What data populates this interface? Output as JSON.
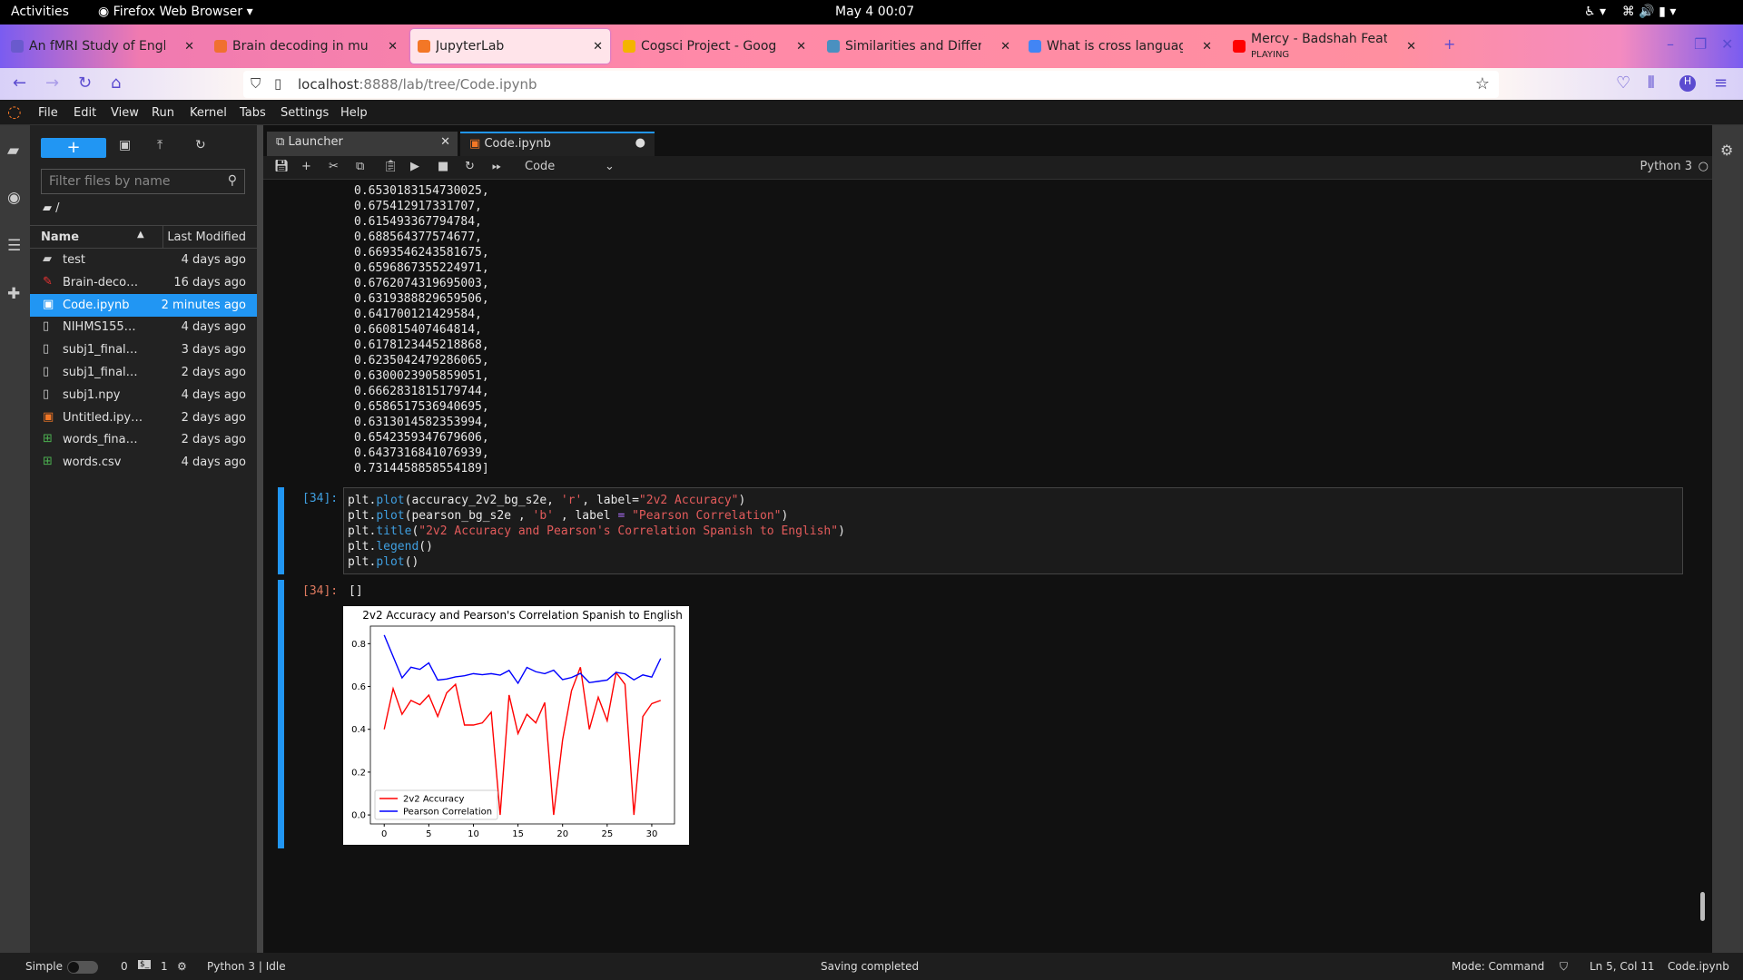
{
  "system": {
    "activities": "Activities",
    "app": "Firefox Web Browser",
    "clock": "May 4  00:07"
  },
  "browser": {
    "tabs": [
      {
        "title": "An fMRI Study of English",
        "color": "#6a5acd"
      },
      {
        "title": "Brain decoding in multipl",
        "color": "#f07030"
      },
      {
        "title": "JupyterLab",
        "color": "#f37726"
      },
      {
        "title": "Cogsci Project - Google Sl",
        "color": "#f4b400"
      },
      {
        "title": "Similarities and Differenc",
        "color": "#4a90c0"
      },
      {
        "title": "What is cross language si",
        "color": "#4285f4"
      },
      {
        "title": "Mercy - Badshah Feat. La",
        "sub": "PLAYING",
        "color": "#ff0000"
      }
    ],
    "url_host": "localhost",
    "url_rest": ":8888/lab/tree/Code.ipynb"
  },
  "menu": [
    "File",
    "Edit",
    "View",
    "Run",
    "Kernel",
    "Tabs",
    "Settings",
    "Help"
  ],
  "filebrowser": {
    "filter_placeholder": "Filter files by name",
    "path": "/",
    "col_name": "Name",
    "col_modified": "Last Modified",
    "files": [
      {
        "name": "test",
        "modified": "4 days ago",
        "type": "folder"
      },
      {
        "name": "Brain-deco…",
        "modified": "16 days ago",
        "type": "pdf"
      },
      {
        "name": "Code.ipynb",
        "modified": "2 minutes ago",
        "type": "notebook",
        "selected": true
      },
      {
        "name": "NIHMS155…",
        "modified": "4 days ago",
        "type": "file"
      },
      {
        "name": "subj1_final…",
        "modified": "3 days ago",
        "type": "file"
      },
      {
        "name": "subj1_final…",
        "modified": "2 days ago",
        "type": "file"
      },
      {
        "name": "subj1.npy",
        "modified": "4 days ago",
        "type": "file"
      },
      {
        "name": "Untitled.ipy…",
        "modified": "2 days ago",
        "type": "notebook"
      },
      {
        "name": "words_fina…",
        "modified": "2 days ago",
        "type": "csv"
      },
      {
        "name": "words.csv",
        "modified": "4 days ago",
        "type": "csv"
      }
    ]
  },
  "notebook": {
    "tabs": [
      {
        "label": "Launcher"
      },
      {
        "label": "Code.ipynb"
      }
    ],
    "cell_type": "Code",
    "kernel": "Python 3",
    "output_values": [
      "0.6530183154730025,",
      "0.675412917331707,",
      "0.615493367794784,",
      "0.688564377574677,",
      "0.6693546243581675,",
      "0.6596867355224971,",
      "0.6762074319695003,",
      "0.6319388829659506,",
      "0.641700121429584,",
      "0.660815407464814,",
      "0.6178123445218868,",
      "0.6235042479286065,",
      "0.6300023905859051,",
      "0.6662831815179744,",
      "0.6586517536940695,",
      "0.6313014582353994,",
      "0.6542359347679606,",
      "0.6437316841076939,",
      "0.7314458858554189]"
    ],
    "in_prompt": "[34]:",
    "out_prompt": "[34]:",
    "out_text": "[]",
    "code": [
      [
        [
          "plt.",
          "kp"
        ],
        [
          "plot",
          "kf"
        ],
        [
          "(accuracy_2v2_bg_s2e, ",
          "kp"
        ],
        [
          "'r'",
          "ks"
        ],
        [
          ", label=",
          "kp"
        ],
        [
          "\"2v2 Accuracy\"",
          "ks"
        ],
        [
          ")",
          "kp"
        ]
      ],
      [
        [
          "plt.",
          "kp"
        ],
        [
          "plot",
          "kf"
        ],
        [
          "(pearson_bg_s2e , ",
          "kp"
        ],
        [
          "'b'",
          "ks"
        ],
        [
          " , label ",
          "kp"
        ],
        [
          "=",
          "ko"
        ],
        [
          " ",
          "kp"
        ],
        [
          "\"Pearson Correlation\"",
          "ks"
        ],
        [
          ")",
          "kp"
        ]
      ],
      [
        [
          "plt.",
          "kp"
        ],
        [
          "title",
          "kf"
        ],
        [
          "(",
          "kp"
        ],
        [
          "\"2v2 Accuracy and Pearson's Correlation Spanish to English\"",
          "ks"
        ],
        [
          ")",
          "kp"
        ]
      ],
      [
        [
          "plt.",
          "kp"
        ],
        [
          "legend",
          "kf"
        ],
        [
          "()",
          "kp"
        ]
      ],
      [
        [
          "plt.",
          "kp"
        ],
        [
          "plot",
          "kf"
        ],
        [
          "()",
          "kp"
        ]
      ]
    ]
  },
  "chart_data": {
    "type": "line",
    "title": "2v2 Accuracy and Pearson's Correlation Spanish to English",
    "xlabel": "",
    "ylabel": "",
    "xlim": [
      -1.55,
      32.55
    ],
    "ylim": [
      -0.042,
      0.882
    ],
    "xticks": [
      0,
      5,
      10,
      15,
      20,
      25,
      30
    ],
    "yticks": [
      0.0,
      0.2,
      0.4,
      0.6,
      0.8
    ],
    "ytick_labels": [
      "0.0",
      "0.2",
      "0.4",
      "0.6",
      "0.8"
    ],
    "legend_position": "lower-left",
    "x": [
      0,
      1,
      2,
      3,
      4,
      5,
      6,
      7,
      8,
      9,
      10,
      11,
      12,
      13,
      14,
      15,
      16,
      17,
      18,
      19,
      20,
      21,
      22,
      23,
      24,
      25,
      26,
      27,
      28,
      29,
      30,
      31
    ],
    "series": [
      {
        "name": "2v2 Accuracy",
        "color": "#ff0000",
        "values": [
          0.4,
          0.59,
          0.47,
          0.535,
          0.515,
          0.56,
          0.46,
          0.57,
          0.61,
          0.42,
          0.42,
          0.43,
          0.48,
          0.0,
          0.56,
          0.38,
          0.47,
          0.43,
          0.525,
          0.0,
          0.35,
          0.58,
          0.69,
          0.4,
          0.55,
          0.44,
          0.665,
          0.61,
          0.0,
          0.46,
          0.52,
          0.535
        ]
      },
      {
        "name": "Pearson Correlation",
        "color": "#0000ff",
        "values": [
          0.84,
          0.74,
          0.64,
          0.69,
          0.68,
          0.71,
          0.63,
          0.635,
          0.645,
          0.65,
          0.66,
          0.655,
          0.66,
          0.653,
          0.675,
          0.615,
          0.689,
          0.669,
          0.66,
          0.676,
          0.632,
          0.642,
          0.661,
          0.618,
          0.624,
          0.63,
          0.666,
          0.659,
          0.631,
          0.654,
          0.644,
          0.731
        ]
      }
    ]
  },
  "status": {
    "mode_simple": "Simple",
    "count0": "0",
    "count1": "1",
    "kernel": "Python 3 | Idle",
    "saving": "Saving completed",
    "mode": "Mode: Command",
    "cursor": "Ln 5, Col 11",
    "file": "Code.ipynb"
  }
}
